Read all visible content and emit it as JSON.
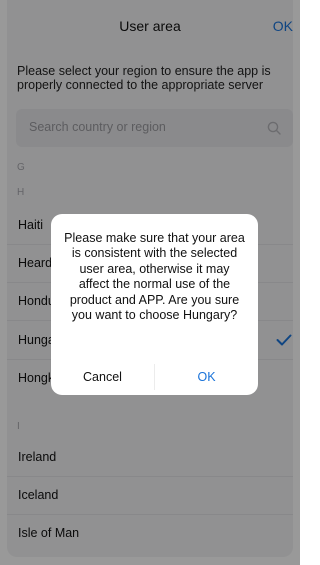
{
  "header": {
    "title": "User area",
    "ok_label": "OK"
  },
  "intro_text": "Please select your region to ensure the app is properly connected to the appropriate server",
  "search": {
    "placeholder": "Search country or region"
  },
  "sections": {
    "g": "G",
    "h": "H",
    "i": "I"
  },
  "h_items": [
    {
      "label": "Haiti"
    },
    {
      "label": "Heard Island and McDonald Islands"
    },
    {
      "label": "Honduras"
    },
    {
      "label": "Hungary",
      "selected": true
    },
    {
      "label": "Hongkong"
    }
  ],
  "i_items": [
    {
      "label": "Ireland"
    },
    {
      "label": "Iceland"
    },
    {
      "label": "Isle of Man"
    }
  ],
  "dialog": {
    "message": "Please make sure that your area is consistent with the selected user area, otherwise it may affect the normal use of the product and APP. Are you sure you want to choose Hungary?",
    "cancel_label": "Cancel",
    "ok_label": "OK"
  },
  "colors": {
    "accent": "#1a73d9",
    "overlay": "rgba(0,0,0,0.40)"
  }
}
